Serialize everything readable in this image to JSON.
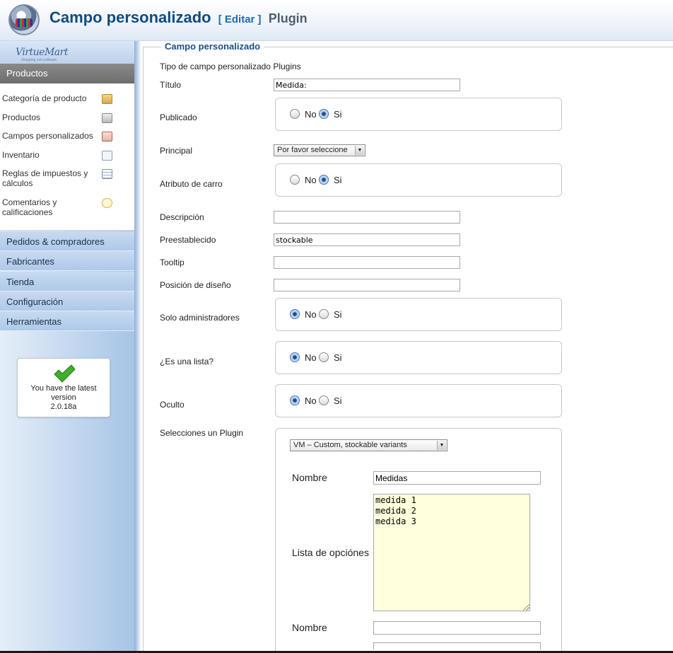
{
  "header": {
    "title": "Campo personalizado",
    "edit_label": "[ Editar ]",
    "plugin_label": "Plugin"
  },
  "sidebar": {
    "brand": "VirtueMart",
    "brand_tagline": "shopping cart software",
    "section_title": "Productos",
    "sub_items": [
      {
        "label": "Categoría de producto",
        "icon": "folder-icon"
      },
      {
        "label": "Productos",
        "icon": "box-icon"
      },
      {
        "label": "Campos personalizados",
        "icon": "custom-fields-icon"
      },
      {
        "label": "Inventario",
        "icon": "chart-icon"
      },
      {
        "label": "Reglas de impuestos y cálculos",
        "icon": "calculator-icon"
      },
      {
        "label": "Comentarios y calificaciones",
        "icon": "comment-icon"
      }
    ],
    "menu": [
      "Pedidos & compradores",
      "Fabricantes",
      "Tienda",
      "Configuración",
      "Herramientas"
    ],
    "version_notice": {
      "line1": "You have the latest version",
      "version": "2.0.18a"
    }
  },
  "form": {
    "legend": "Campo personalizado",
    "type_text": "Tipo de campo personalizado Plugins",
    "titulo_label": "Título",
    "titulo_value": "Medida:",
    "publicado_label": "Publicado",
    "principal_label": "Principal",
    "principal_value": "Por favor seleccione",
    "atributo_label": "Atributo de carro",
    "descripcion_label": "Descripción",
    "descripcion_value": "",
    "preestablecido_label": "Preestablecido",
    "preestablecido_value": "stockable",
    "tooltip_label": "Tooltip",
    "tooltip_value": "",
    "posicion_label": "Posición de diseño",
    "posicion_value": "",
    "solo_admin_label": "Solo administradores",
    "es_lista_label": "¿Es una lista?",
    "oculto_label": "Oculto",
    "plugin_label": "Selecciones un Plugin",
    "no_label": "No",
    "si_label": "Si",
    "radios": {
      "publicado": "Si",
      "atributo": "Si",
      "solo_admin": "No",
      "es_lista": "No",
      "oculto": "No"
    },
    "plugin": {
      "select_value": "VM – Custom, stockable variants",
      "nombre_label": "Nombre",
      "nombre_value": "Medidas",
      "lista_label": "Lista de opciónes",
      "lista_value": "medida 1\nmedida 2\nmedida 3",
      "nombre2_label": "Nombre",
      "nombre2_value": ""
    }
  },
  "colors": {
    "title": "#0f4c81",
    "accent": "#1e6bb0",
    "sidebar": "#b9d1ec",
    "textarea_bg": "#ffffdd"
  }
}
